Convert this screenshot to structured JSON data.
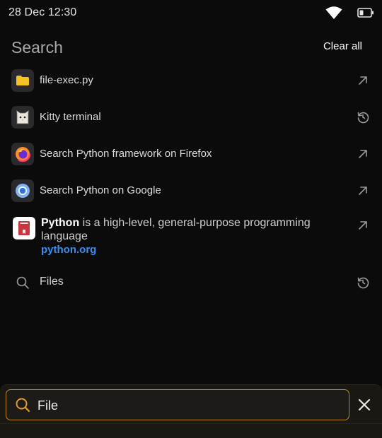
{
  "status_bar": {
    "time": "28 Dec  12:30",
    "icons": [
      "wifi-icon",
      "battery-icon"
    ]
  },
  "header": {
    "title": "Search",
    "clear_all": "Clear all"
  },
  "results": [
    {
      "label": "file-exec.py",
      "icon": "folder-icon",
      "action": "open-arrow-icon"
    },
    {
      "label": "Kitty terminal",
      "icon": "kitty-app-icon",
      "action": "history-icon"
    },
    {
      "label": "Search Python framework on Firefox",
      "icon": "firefox-icon",
      "action": "open-arrow-icon"
    },
    {
      "label": "Search Python on Google",
      "icon": "chrome-icon",
      "action": "open-arrow-icon"
    }
  ],
  "web_result": {
    "title_bold": "Python",
    "description": " is a high-level, general-purpose programming language",
    "link": "python.org",
    "icon": "book-icon",
    "action": "open-arrow-icon"
  },
  "files_suggestion": {
    "label": "Files",
    "icon": "search-icon",
    "action": "history-icon"
  },
  "search": {
    "value": "File",
    "placeholder": "",
    "accent": "#c0871c"
  },
  "colors": {
    "background": "#0b0b0c",
    "link": "#3d8ef0",
    "folder": "#f5c022"
  }
}
